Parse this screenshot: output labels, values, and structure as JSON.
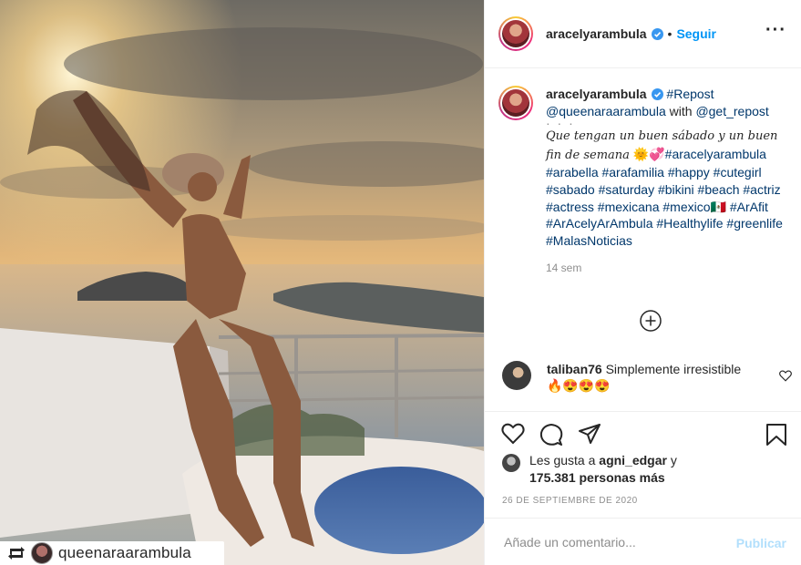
{
  "post": {
    "username": "aracelyarambula",
    "follow_label": "Seguir",
    "more_label": "···",
    "separator": "•"
  },
  "photo": {
    "repost_username": "queenaraarambula"
  },
  "caption": {
    "username": "aracelyarambula",
    "first_hashtag": "#Repost",
    "mention_1": "@queenaraarambula",
    "with_word": " with ",
    "mention_2": "@get_repost",
    "dots": "·\n·\n·",
    "script_text": "Que tengan un buen sábado y un buen fin de semana",
    "emoji": "🌞💞",
    "hashtags": "#aracelyarambula #arabella #arafamilia #happy #cutegirl #sabado #saturday #bikini #beach #actriz #actress #mexicana #mexico🇲🇽 #ArAfit #ArAcelyArAmbula #Healthylife #greenlife #MalasNoticias",
    "time": "14 sem"
  },
  "comment": {
    "username": "taliban76",
    "text": "Simplemente irresistible",
    "emoji": "🔥😍😍😍"
  },
  "likes": {
    "prefix": "Les gusta a ",
    "user": "agni_edgar",
    "connector": " y",
    "count": "175.381 personas más"
  },
  "date": "26 DE SEPTIEMBRE DE 2020",
  "add_comment": {
    "placeholder": "Añade un comentario...",
    "publish_label": "Publicar"
  },
  "colors": {
    "accent": "#0095f6",
    "publish_disabled": "#b2dffc",
    "muted": "#8e8e8e"
  }
}
